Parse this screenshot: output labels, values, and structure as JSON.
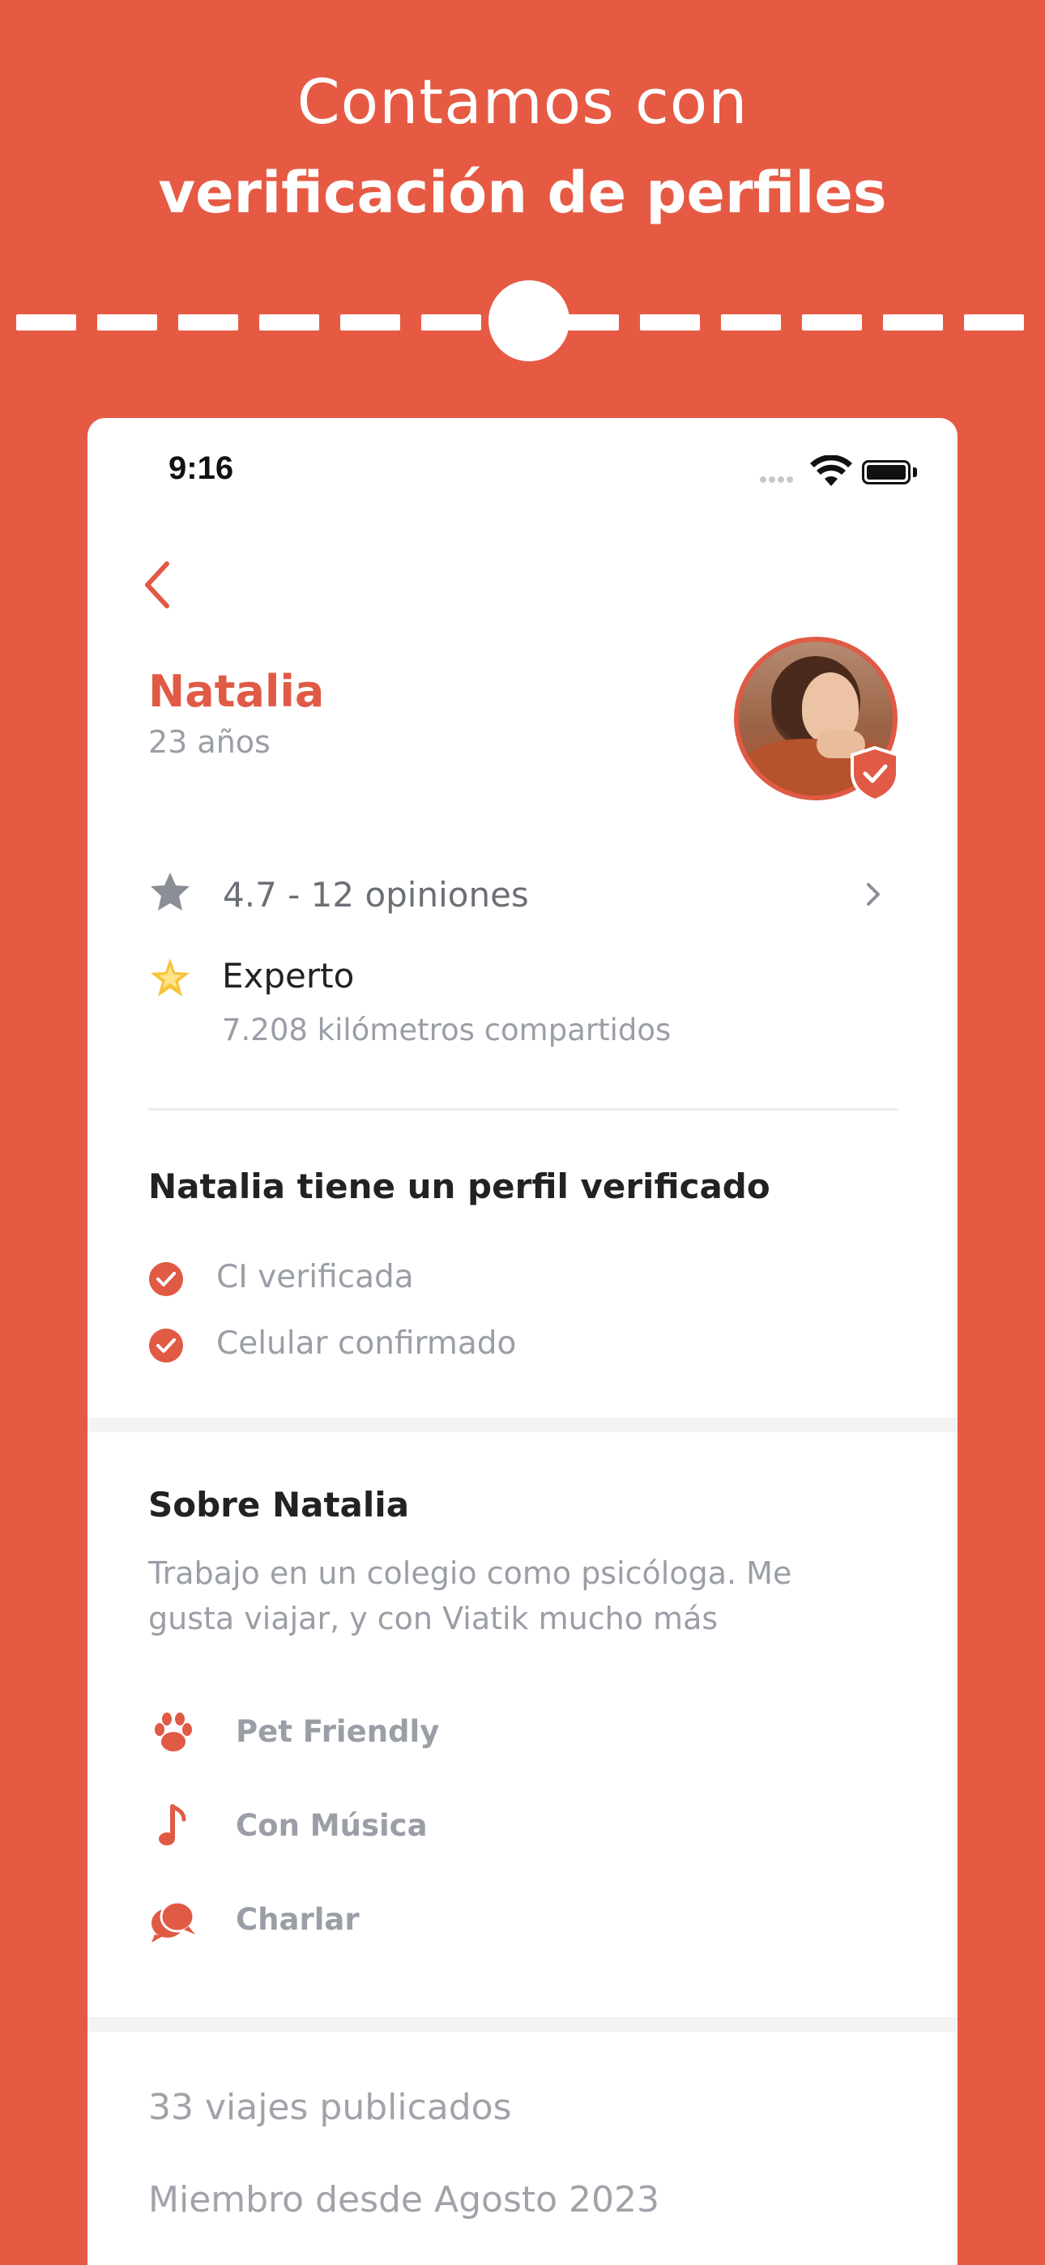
{
  "colors": {
    "brand": "#E65A44",
    "accent": "#E05A45",
    "muted": "#9a9ea6",
    "dark": "#222222"
  },
  "banner": {
    "line1": "Contamos con",
    "line2": "verificación de perfiles"
  },
  "status_bar": {
    "time": "9:16"
  },
  "profile": {
    "name": "Natalia",
    "age": "23 años",
    "verified": true,
    "rating_text": "4.7 - 12 opiniones",
    "level_title": "Experto",
    "level_subtitle": "7.208 kilómetros compartidos"
  },
  "verification": {
    "title": "Natalia tiene un perfil verificado",
    "items": [
      "CI verificada",
      "Celular confirmado"
    ]
  },
  "about": {
    "title": "Sobre Natalia",
    "text": "Trabajo en un colegio como psicóloga. Me gusta viajar, y con Viatik mucho más",
    "preferences": [
      {
        "icon": "paw-icon",
        "label": "Pet Friendly"
      },
      {
        "icon": "music-note-icon",
        "label": "Con Música"
      },
      {
        "icon": "chat-bubbles-icon",
        "label": "Charlar"
      }
    ]
  },
  "stats": {
    "trips": "33 viajes publicados",
    "member_since": "Miembro desde Agosto 2023"
  }
}
